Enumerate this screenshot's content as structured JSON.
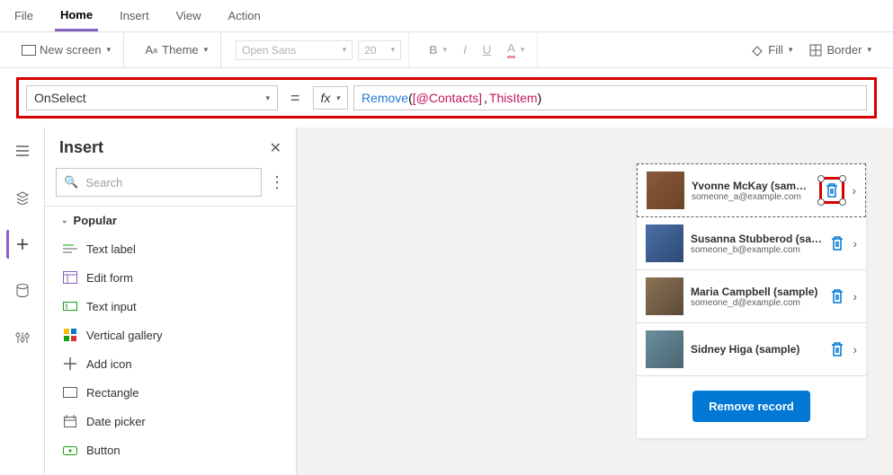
{
  "menubar": {
    "items": [
      "File",
      "Home",
      "Insert",
      "View",
      "Action"
    ],
    "active": "Home"
  },
  "toolbar": {
    "new_screen": "New screen",
    "theme": "Theme",
    "font": "Open Sans",
    "font_size": "20",
    "fill": "Fill",
    "border": "Border"
  },
  "formula": {
    "property": "OnSelect",
    "fx": "fx",
    "tokens": {
      "func": "Remove",
      "open": "( ",
      "entity": "[@Contacts]",
      "comma": ", ",
      "this": "ThisItem",
      "close": " )"
    }
  },
  "insert": {
    "title": "Insert",
    "search_placeholder": "Search",
    "section": "Popular",
    "items": [
      {
        "label": "Text label",
        "icon": "text"
      },
      {
        "label": "Edit form",
        "icon": "form"
      },
      {
        "label": "Text input",
        "icon": "input"
      },
      {
        "label": "Vertical gallery",
        "icon": "gallery"
      },
      {
        "label": "Add icon",
        "icon": "plus"
      },
      {
        "label": "Rectangle",
        "icon": "rect"
      },
      {
        "label": "Date picker",
        "icon": "date"
      },
      {
        "label": "Button",
        "icon": "button"
      }
    ]
  },
  "contacts": [
    {
      "name": "Yvonne McKay (sample)",
      "email": "someone_a@example.com",
      "selected": true
    },
    {
      "name": "Susanna Stubberod (sample)",
      "email": "someone_b@example.com",
      "selected": false
    },
    {
      "name": "Maria Campbell (sample)",
      "email": "someone_d@example.com",
      "selected": false
    },
    {
      "name": "Sidney Higa (sample)",
      "email": "",
      "selected": false
    }
  ],
  "remove_button": "Remove record"
}
